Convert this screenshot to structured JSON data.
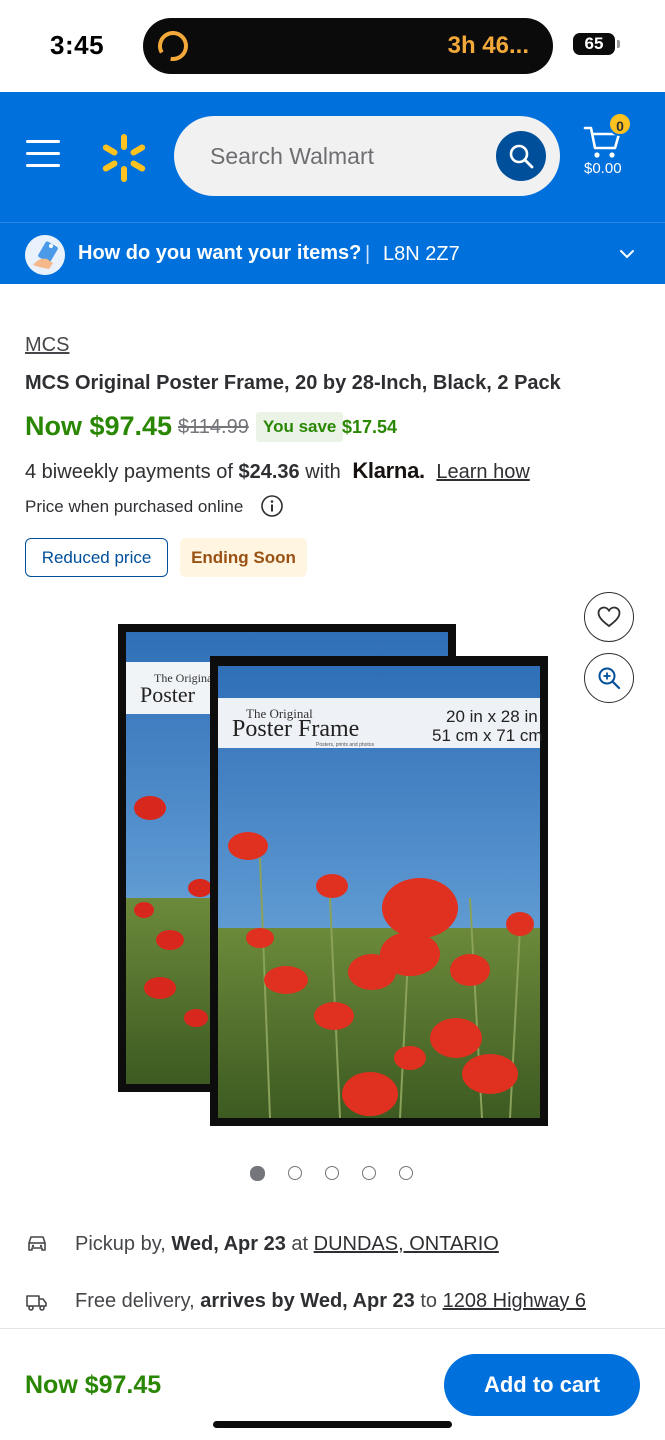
{
  "status_bar": {
    "time": "3:45",
    "timer": "3h 46...",
    "battery": "65"
  },
  "header": {
    "search_placeholder": "Search Walmart",
    "cart_count": "0",
    "cart_total": "$0.00"
  },
  "fulfillment_bar": {
    "question": "How do you want your items?",
    "separator": "|",
    "postal_code": "L8N 2Z7"
  },
  "product": {
    "brand": "MCS",
    "title": "MCS Original Poster Frame, 20 by 28-Inch, Black, 2 Pack",
    "price_now": "Now $97.45",
    "price_was": "$114.99",
    "you_save_label": "You save",
    "save_amount": "$17.54",
    "klarna_prefix": "4 biweekly payments of",
    "klarna_amount": "$24.36",
    "klarna_with": "with",
    "klarna_brand": "Klarna.",
    "learn_how": "Learn how",
    "online_note": "Price when purchased online",
    "tags": {
      "reduced": "Reduced price",
      "ending": "Ending Soon"
    }
  },
  "image": {
    "poster_label_small": "The Original",
    "poster_label_big": "Poster Frame",
    "poster_tagline": "Posters, prints and photos",
    "size_in": "20 in x 28 in",
    "size_cm": "51 cm x 71 cm",
    "back_label_small": "The Original",
    "back_label_big": "Poster",
    "slide_count": 5,
    "active_slide": 1
  },
  "delivery": {
    "pickup_prefix": "Pickup by,",
    "pickup_date": "Wed, Apr 23",
    "pickup_at": "at",
    "pickup_location": "DUNDAS, ONTARIO",
    "delivery_prefix": "Free delivery,",
    "delivery_date": "arrives by Wed, Apr 23",
    "delivery_to": "to",
    "delivery_address": "1208 Highway 6"
  },
  "bottom_bar": {
    "price": "Now $97.45",
    "add_to_cart": "Add to cart"
  },
  "colors": {
    "brand_blue": "#0071dc",
    "spark_yellow": "#ffc220",
    "price_green": "#2a8703",
    "dark_blue": "#004f9a"
  },
  "icons": [
    "menu-icon",
    "spark-logo-icon",
    "search-icon",
    "cart-icon",
    "delivery-person-icon",
    "chevron-down-icon",
    "info-icon",
    "heart-icon",
    "zoom-in-icon",
    "car-icon",
    "truck-icon"
  ]
}
